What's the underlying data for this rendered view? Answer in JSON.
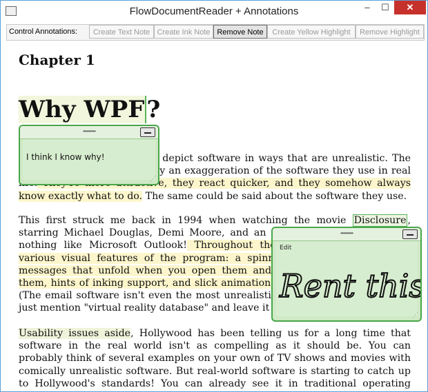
{
  "window": {
    "title": "FlowDocumentReader + Annotations",
    "controls": {
      "minimize": "–",
      "maximize": "☐",
      "close": "✕"
    }
  },
  "toolbar": {
    "label": "Control Annotations:",
    "buttons": [
      {
        "label": "Create Text Note",
        "enabled": false
      },
      {
        "label": "Create Ink Note",
        "enabled": false
      },
      {
        "label": "Remove Note",
        "enabled": true
      },
      {
        "label": "Create Yellow Highlight",
        "enabled": false
      },
      {
        "label": "Remove Highlight",
        "enabled": false
      }
    ]
  },
  "document": {
    "chapter": "Chapter 1",
    "heading_anchor": "Why WPF",
    "heading_tail": "?",
    "p1": {
      "a": "Movies and television often depict software in ways that are unrealistic. The main characters are typically an exaggeration of the software they use in real life.",
      "hl": " They're more attractive, they react quicker, and they somehow always know exactly what to do.",
      "b": " The same could be said about the software they use."
    },
    "p2": {
      "a": "This first struck me back in 1994 when watching the movie ",
      "anchor": "Disclosure",
      "b": ", starring Michael Douglas, Demi Moore, and an email program that looked nothing like Microsoft Outlook!",
      "hl": " Throughout the movie, we're treated to various visual features of the program: a spinning three-dimensional \"e,\" messages that unfold when you open them and crumple when you delete them, hints of inking support, and slick animations when you print messages.",
      "c": " (The email software isn't even the most unrealistic software in the movie. I'll just mention \"virtual reality database\" and leave it at that.)"
    },
    "p3": {
      "anchor": "Usability issues aside",
      "b": ", Hollywood has been telling us for a long time that software in the real world isn't as compelling as it should be. You can probably think of several examples on your own of TV shows and movies with comically unrealistic software. But real-world software is starting to catch up to Hollywood's standards! You can already see it in traditional operating systems"
    }
  },
  "notes": {
    "text_note": {
      "grip": "••••••••••",
      "text": "I think I know why!"
    },
    "ink_note": {
      "grip": "••••••••••",
      "menu": "Edit",
      "ink_text": "Rent this!"
    }
  },
  "colors": {
    "yellow_highlight": "#fdf6cc",
    "note_border": "#48a64a",
    "note_fill": "#cfe9c5",
    "close_button": "#c7312b"
  }
}
